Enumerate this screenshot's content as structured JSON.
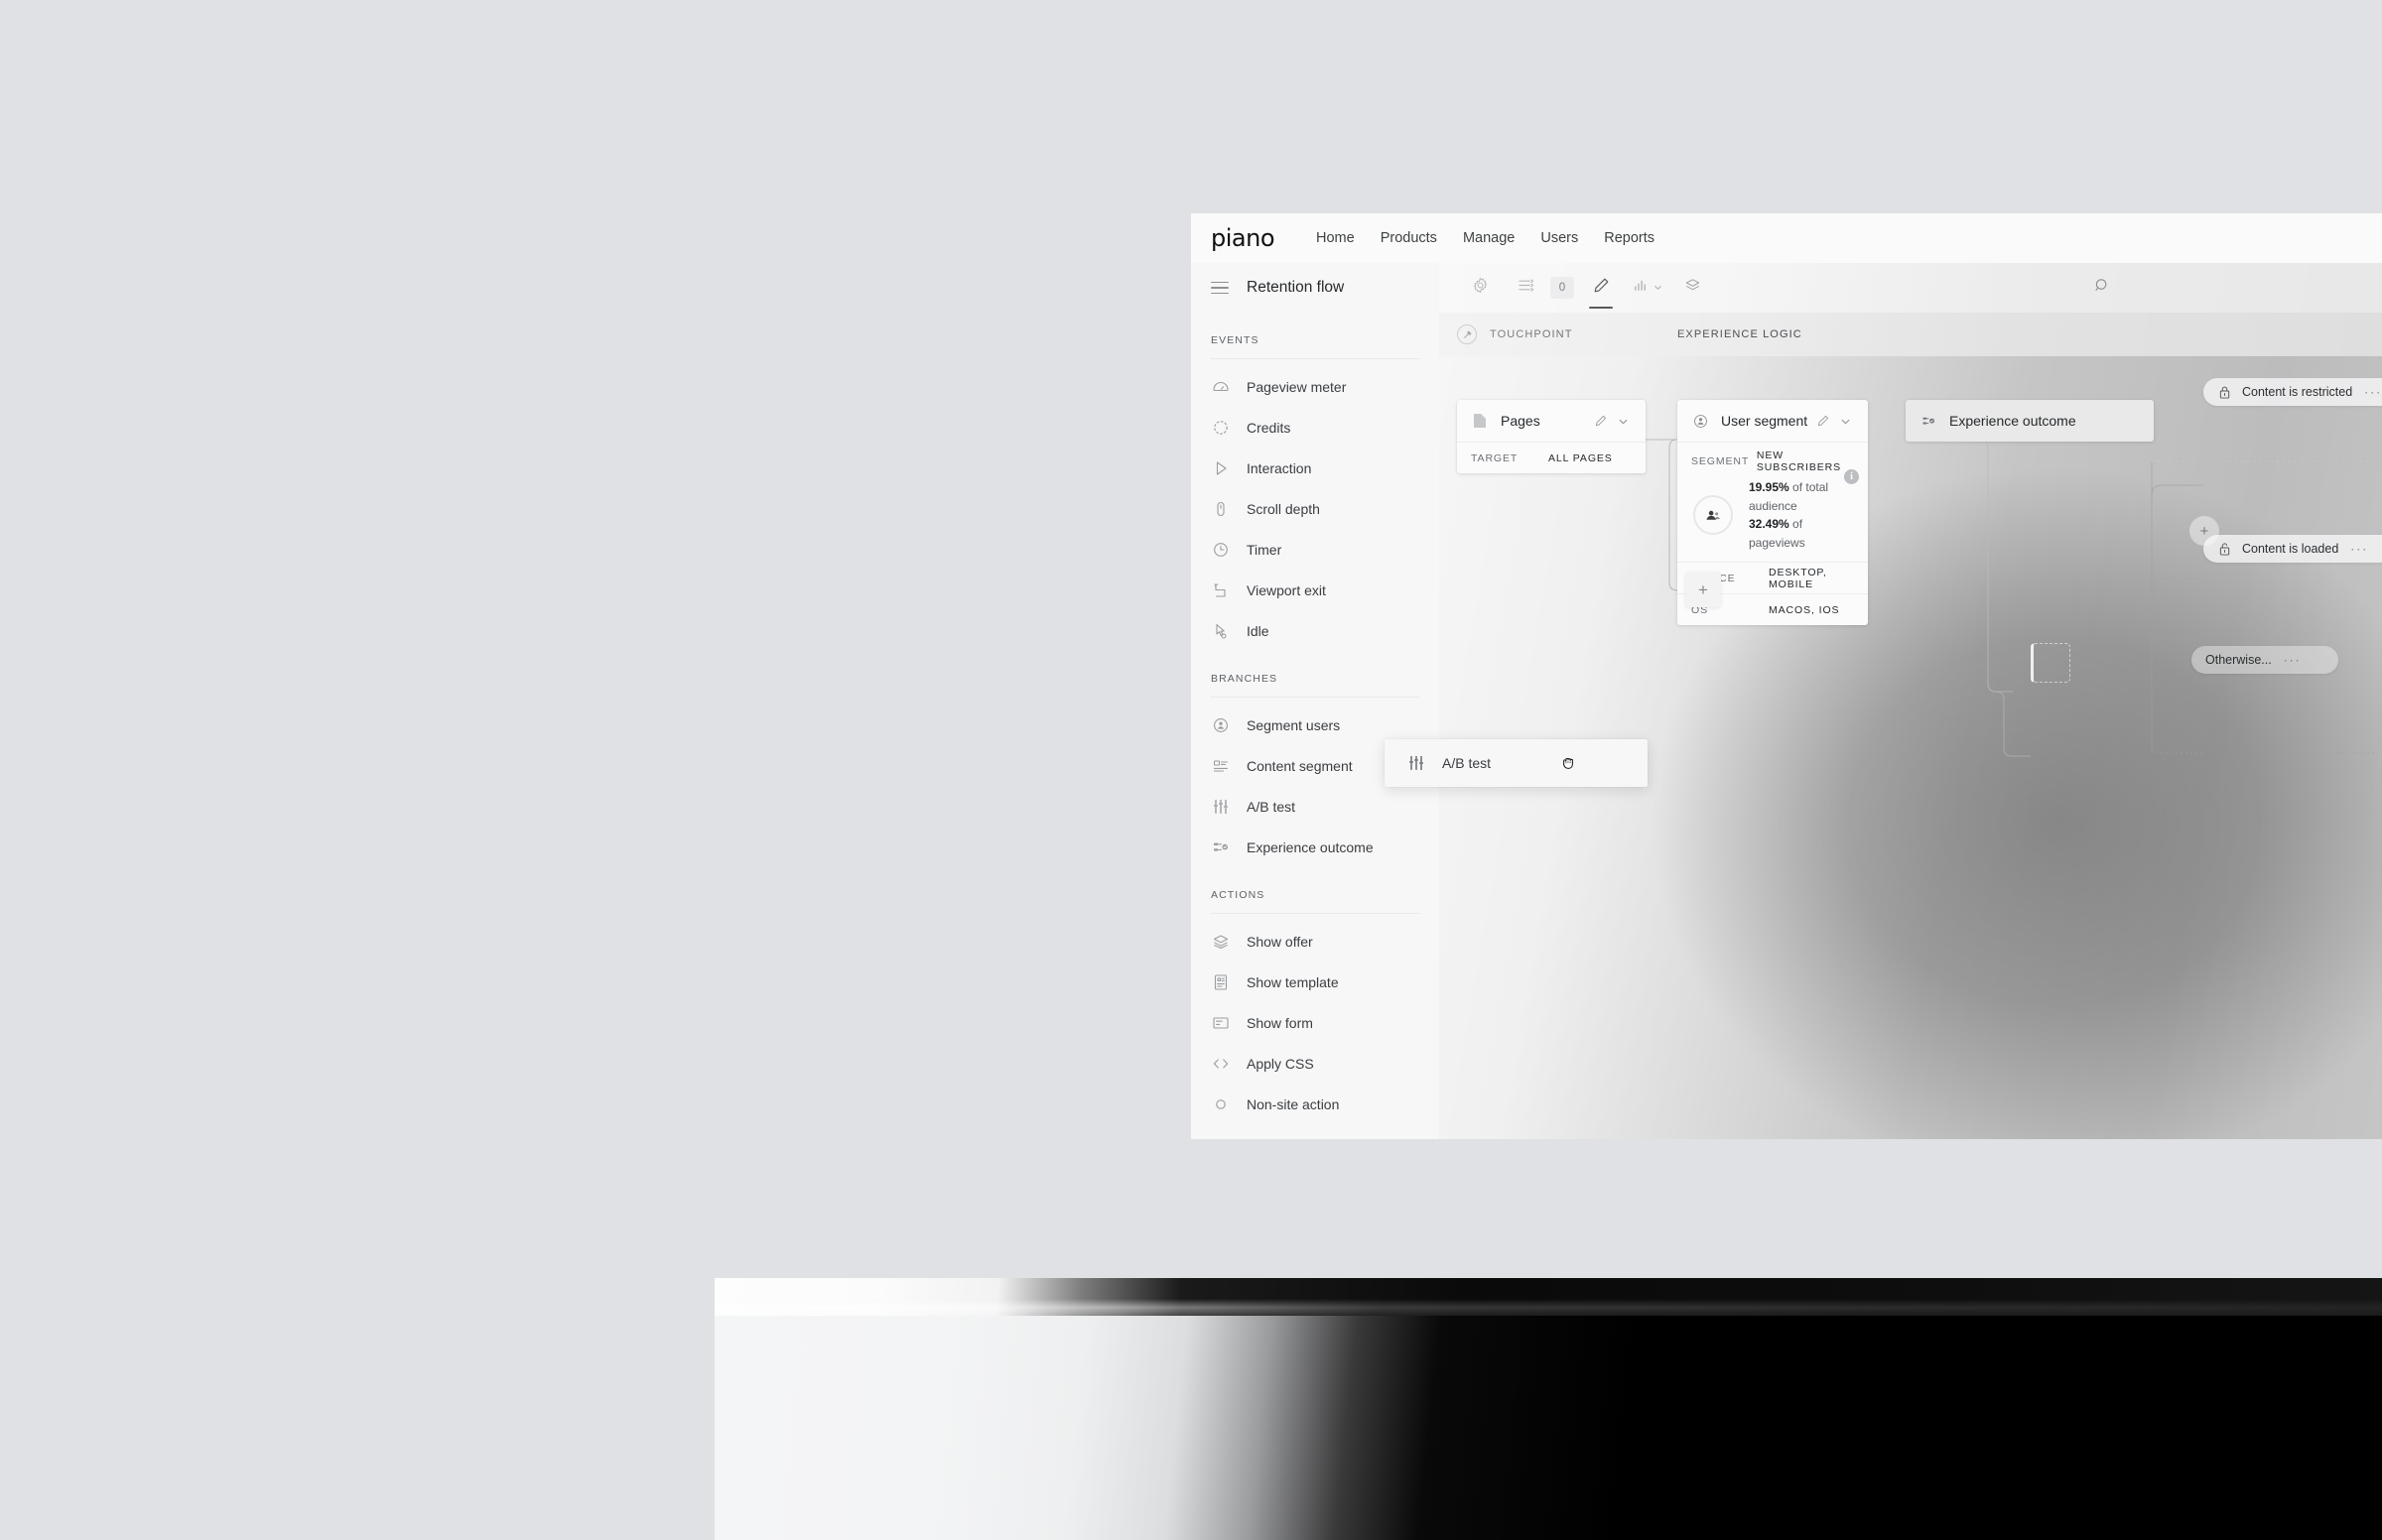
{
  "background_color": "#e0e1e4",
  "app": {
    "brand": "piano",
    "nav_items": [
      {
        "label": "Home"
      },
      {
        "label": "Products"
      },
      {
        "label": "Manage"
      },
      {
        "label": "Users"
      },
      {
        "label": "Reports"
      }
    ]
  },
  "sidebar": {
    "flow_title": "Retention flow",
    "groups": [
      {
        "label": "EVENTS",
        "items": [
          {
            "label": "Pageview meter",
            "icon": "pageview-meter-icon"
          },
          {
            "label": "Credits",
            "icon": "credits-icon"
          },
          {
            "label": "Interaction",
            "icon": "interaction-icon"
          },
          {
            "label": "Scroll depth",
            "icon": "scroll-depth-icon"
          },
          {
            "label": "Timer",
            "icon": "timer-icon"
          },
          {
            "label": "Viewport exit",
            "icon": "viewport-exit-icon"
          },
          {
            "label": "Idle",
            "icon": "idle-icon"
          }
        ]
      },
      {
        "label": "BRANCHES",
        "items": [
          {
            "label": "Segment users",
            "icon": "segment-users-icon"
          },
          {
            "label": "Content segment",
            "icon": "content-segment-icon"
          },
          {
            "label": "A/B test",
            "icon": "ab-test-icon"
          },
          {
            "label": "Experience outcome",
            "icon": "experience-outcome-icon"
          }
        ]
      },
      {
        "label": "ACTIONS",
        "items": [
          {
            "label": "Show offer",
            "icon": "show-offer-icon"
          },
          {
            "label": "Show template",
            "icon": "show-template-icon"
          },
          {
            "label": "Show form",
            "icon": "show-form-icon"
          },
          {
            "label": "Apply CSS",
            "icon": "apply-css-icon"
          },
          {
            "label": "Non-site action",
            "icon": "non-site-action-icon"
          }
        ]
      }
    ]
  },
  "toolbar": {
    "settings_icon": "gear-icon",
    "filters_icon": "sliders-icon",
    "filters_count": "0",
    "edit_icon": "pencil-icon",
    "analytics_icon": "bar-chart-icon",
    "analytics_caret": "chevron-down-icon",
    "layers_icon": "layers-icon",
    "search_icon": "search-icon"
  },
  "canvas": {
    "columns": [
      {
        "label": "TOUCHPOINT",
        "icon": "touchpoint-icon"
      },
      {
        "label": "EXPERIENCE LOGIC",
        "icon": ""
      }
    ],
    "pages_card": {
      "title": "Pages",
      "icon": "page-icon",
      "edit_icon": "pencil-icon",
      "collapse_icon": "chevron-down-icon",
      "rows": [
        {
          "key": "TARGET",
          "value": "ALL PAGES"
        }
      ]
    },
    "user_segment_card": {
      "title": "User segment",
      "icon": "user-circle-icon",
      "edit_icon": "pencil-icon",
      "collapse_icon": "chevron-down-icon",
      "segment_key": "SEGMENT",
      "segment_value": "NEW SUBSCRIBERS",
      "stat_1_value": "19.95%",
      "stat_1_label": " of total audience",
      "stat_2_value": "32.49%",
      "stat_2_label": " of pageviews",
      "donut_percent": 20,
      "info_icon": "info-icon",
      "rows": [
        {
          "key": "DEVICE",
          "value": "DESKTOP, MOBILE"
        },
        {
          "key": "OS",
          "value": "MACOS, IOS"
        }
      ]
    },
    "experience_outcome_card": {
      "title": "Experience outcome",
      "icon": "experience-outcome-icon"
    },
    "outcome_pills": [
      {
        "label": "Content is restricted",
        "icon": "lock-closed-icon",
        "dots": "···"
      },
      {
        "label": "Content is loaded",
        "icon": "lock-open-icon",
        "dots": "···"
      }
    ],
    "otherwise_pill": {
      "label": "Otherwise...",
      "dots": "···"
    },
    "add_node_button": "+",
    "add_branch_button": "+"
  },
  "drag_ghost": {
    "label": "A/B test",
    "icon": "ab-test-icon",
    "cursor": "grabbing-hand-cursor"
  }
}
